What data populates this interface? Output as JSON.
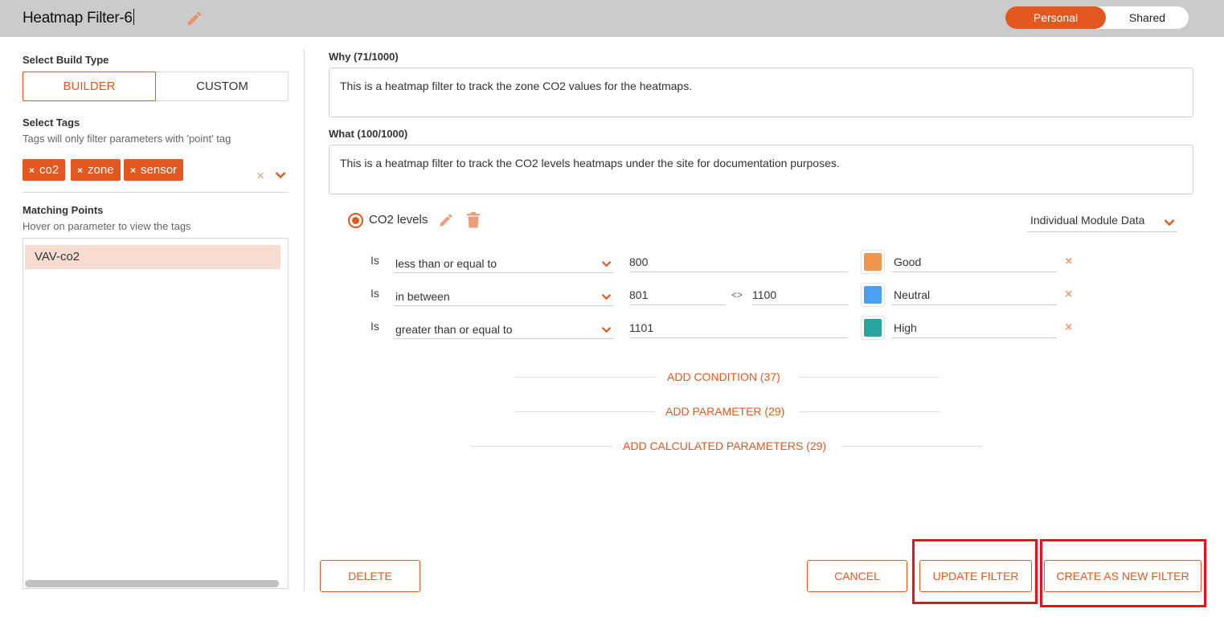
{
  "header": {
    "title": "Heatmap Filter-6",
    "visibility_toggle": {
      "personal": "Personal",
      "shared": "Shared",
      "selected": "Personal"
    }
  },
  "left_panel": {
    "build_type": {
      "label": "Select Build Type",
      "options": [
        "BUILDER",
        "CUSTOM"
      ],
      "selected": "BUILDER"
    },
    "tags": {
      "label": "Select Tags",
      "hint": "Tags will only filter parameters with 'point' tag",
      "selected": [
        "co2",
        "zone",
        "sensor"
      ],
      "remove_glyph": "×",
      "clear_glyph": "×"
    },
    "matching_points": {
      "label": "Matching Points",
      "hint": "Hover on parameter to view the tags",
      "items": [
        "VAV-co2"
      ]
    }
  },
  "why": {
    "label": "Why (71/1000)",
    "value": "This is a heatmap filter to track the zone CO2 values for the heatmaps."
  },
  "what": {
    "label": "What (100/1000)",
    "value": "This is a heatmap filter to track the CO2 levels heatmaps under the site for documentation purposes."
  },
  "parameter": {
    "name": "CO2 levels",
    "data_source": "Individual Module Data",
    "conditions": [
      {
        "is_label": "Is",
        "operator": "less than or equal to",
        "value": "800",
        "value2": "",
        "color": "#f0954f",
        "label": "Good",
        "remove": "×"
      },
      {
        "is_label": "Is",
        "operator": "in between",
        "value": "801",
        "range_sep": "<>",
        "value2": "1100",
        "color": "#4a9ff0",
        "label": "Neutral",
        "remove": "×"
      },
      {
        "is_label": "Is",
        "operator": "greater than or equal to",
        "value": "1101",
        "value2": "",
        "color": "#27a3a0",
        "label": "High",
        "remove": "×"
      }
    ]
  },
  "add_actions": {
    "condition": "ADD CONDITION (37)",
    "parameter": "ADD PARAMETER (29)",
    "calculated": "ADD CALCULATED PARAMETERS (29)"
  },
  "footer": {
    "delete": "DELETE",
    "cancel": "CANCEL",
    "update": "UPDATE FILTER",
    "create_new": "CREATE AS NEW FILTER"
  },
  "colors": {
    "accent": "#e2581f",
    "highlight": "#e3141b",
    "header_bg": "#cbcbcb"
  }
}
